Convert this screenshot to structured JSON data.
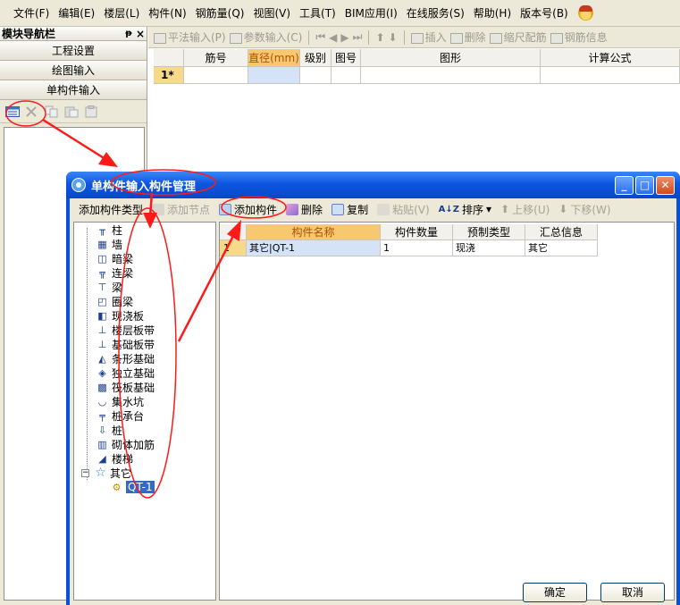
{
  "menu": {
    "items": [
      "文件(F)",
      "编辑(E)",
      "楼层(L)",
      "构件(N)",
      "钢筋量(Q)",
      "视图(V)",
      "工具(T)",
      "BIM应用(I)",
      "在线服务(S)",
      "帮助(H)",
      "版本号(B)"
    ]
  },
  "nav": {
    "title": "模块导航栏",
    "pin": "ᵽ",
    "close": "×",
    "buttons": [
      "工程设置",
      "绘图输入",
      "单构件输入"
    ]
  },
  "toolbar": {
    "items": [
      "平法输入(P)",
      "参数输入(C)",
      "插入",
      "删除",
      "缩尺配筋",
      "钢筋信息"
    ]
  },
  "main_grid": {
    "headers": [
      "筋号",
      "直径(mm)",
      "级别",
      "图号",
      "图形",
      "计算公式"
    ],
    "row_label": "1*"
  },
  "dialog": {
    "title": "单构件输入构件管理",
    "toolbar": {
      "add_type": "添加构件类型",
      "add_node": "添加节点",
      "add_component": "添加构件",
      "delete": "删除",
      "copy": "复制",
      "paste": "粘贴(V)",
      "sort": "排序",
      "move_up": "上移(U)",
      "move_down": "下移(W)"
    },
    "tree": {
      "items": [
        "柱",
        "墙",
        "暗梁",
        "连梁",
        "梁",
        "圈梁",
        "现浇板",
        "楼层板带",
        "基础板带",
        "条形基础",
        "独立基础",
        "筏板基础",
        "集水坑",
        "桩承台",
        "桩",
        "砌体加筋",
        "楼梯",
        "其它"
      ],
      "child": "QT-1"
    },
    "grid": {
      "headers": [
        "构件名称",
        "构件数量",
        "预制类型",
        "汇总信息"
      ],
      "row_num": "1",
      "row": [
        "其它|QT-1",
        "1",
        "现浇",
        "其它"
      ]
    },
    "ok": "确定",
    "cancel": "取消"
  },
  "colors": {
    "annotation_red": "#ff1a1a",
    "selected_header": "#f7c870",
    "title_bar_blue": "#0a4fd8"
  }
}
